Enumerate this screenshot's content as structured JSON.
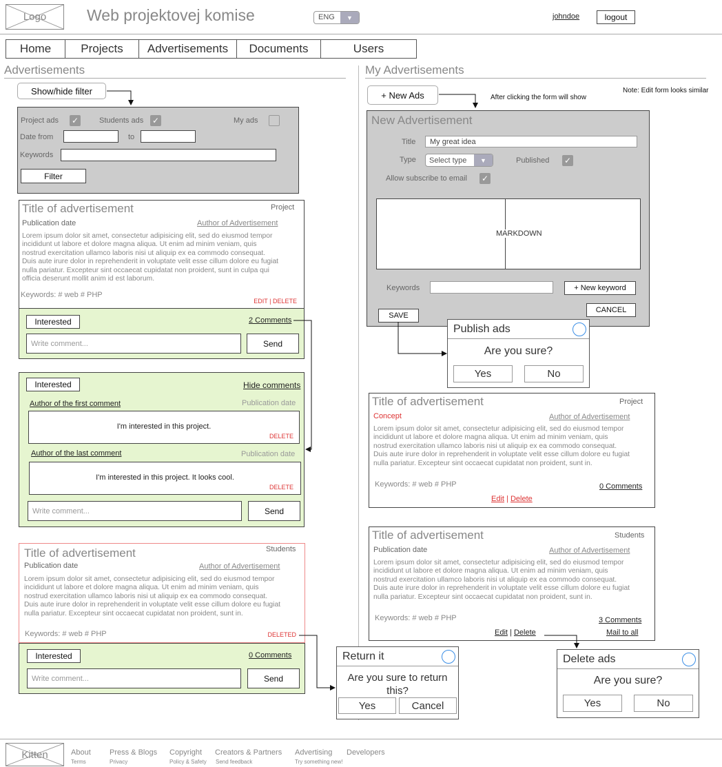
{
  "header": {
    "logo": "Logo",
    "app_title": "Web projektovej komise",
    "language": "ENG",
    "username": "johndoe",
    "logout_label": "logout"
  },
  "nav": [
    "Home",
    "Projects",
    "Advertisements",
    "Documents",
    "Users"
  ],
  "left": {
    "section_title": "Advertisements",
    "toggle_filter_label": "Show/hide filter",
    "filter": {
      "project_ads_label": "Project ads",
      "students_ads_label": "Students ads",
      "my_ads_label": "My ads",
      "date_from_label": "Date from",
      "date_to_label": "to",
      "keywords_label": "Keywords",
      "filter_button": "Filter"
    },
    "ad1": {
      "title": "Title of advertisement",
      "type": "Project",
      "date": "Publication date",
      "author": "Author of Advertisement",
      "lines": [
        "Lorem ipsum dolor sit amet, consectetur adipisicing elit, sed do eiusmod tempor",
        "incididunt ut labore et dolore magna aliqua. Ut enim ad minim veniam, quis",
        "nostrud exercitation ullamco laboris nisi ut aliquip ex ea commodo consequat.",
        "Duis aute irure dolor in reprehenderit in voluptate velit esse cillum dolore eu fugiat",
        "nulla pariatur. Excepteur sint occaecat cupidatat non proident, sunt in culpa qui",
        "officia deserunt mollit anim id est laborum."
      ],
      "keywords": "Keywords:  # web # PHP",
      "actions": "EDIT | DELETE"
    },
    "ad1_panel": {
      "interested": "Interested",
      "comments": "2 Comments",
      "comment_placeholder": "Write comment...",
      "send": "Send"
    },
    "comments_panel": {
      "interested": "Interested",
      "hide_comments": "Hide comments",
      "first_author": "Author of the first comment",
      "first_date": "Publication date",
      "first_text": "I'm interested in this project.",
      "first_delete": "DELETE",
      "last_author": "Author of the last comment",
      "last_date": "Publication date",
      "last_text": "I'm interested in this project. It looks cool.",
      "last_delete": "DELETE",
      "comment_placeholder": "Write comment...",
      "send": "Send"
    },
    "ad2": {
      "title": "Title of advertisement",
      "type": "Students",
      "date": "Publication date",
      "author": "Author of Advertisement",
      "lines": [
        "Lorem ipsum dolor sit amet, consectetur adipisicing elit, sed do eiusmod tempor",
        "incididunt ut labore et dolore magna aliqua. Ut enim ad minim veniam, quis",
        "nostrud exercitation ullamco laboris nisi ut aliquip ex ea commodo consequat.",
        "Duis aute irure dolor in reprehenderit in voluptate velit esse cillum dolore eu fugiat",
        "nulla pariatur. Excepteur sint occaecat cupidatat non proident, sunt in."
      ],
      "keywords": "Keywords:  # web # PHP",
      "status": "DELETED"
    },
    "ad2_panel": {
      "interested": "Interested",
      "comments": "0 Comments",
      "comment_placeholder": "Write comment...",
      "send": "Send"
    }
  },
  "right": {
    "section_title": "My Advertisements",
    "new_ads_label": "+ New Ads",
    "annotation_click": "After clicking the form will show",
    "annotation_edit": "Note: Edit form looks similar",
    "form": {
      "title": "New Advertisement",
      "title_label": "Title",
      "title_value": "My great idea",
      "type_label": "Type",
      "type_value": "Select type",
      "published_label": "Published",
      "subscribe_label": "Allow subscribe to email",
      "editor_label": "MARKDOWN",
      "keywords_label": "Keywords",
      "new_keyword": "+ New keyword",
      "cancel": "CANCEL",
      "save": "SAVE"
    },
    "publish_dialog": {
      "title": "Publish ads",
      "question": "Are you sure?",
      "yes": "Yes",
      "no": "No"
    },
    "ad1": {
      "title": "Title of advertisement",
      "type": "Project",
      "status": "Concept",
      "author": "Author of Advertisement",
      "lines": [
        "Lorem ipsum dolor sit amet, consectetur adipisicing elit, sed do eiusmod tempor",
        "incididunt ut labore et dolore magna aliqua. Ut enim ad minim veniam, quis",
        "nostrud exercitation ullamco laboris nisi ut aliquip ex ea commodo consequat.",
        "Duis aute irure dolor in reprehenderit in voluptate velit esse cillum dolore eu fugiat",
        "nulla pariatur. Excepteur sint occaecat cupidatat non proident, sunt in."
      ],
      "keywords": "Keywords:  # web # PHP",
      "comments": "0 Comments",
      "edit": "Edit",
      "delete": "Delete"
    },
    "ad2": {
      "title": "Title of advertisement",
      "type": "Students",
      "date": "Publication date",
      "author": "Author of Advertisement",
      "lines": [
        "Lorem ipsum dolor sit amet, consectetur adipisicing elit, sed do eiusmod tempor",
        "incididunt ut labore et dolore magna aliqua. Ut enim ad minim veniam, quis",
        "nostrud exercitation ullamco laboris nisi ut aliquip ex ea commodo consequat.",
        "Duis aute irure dolor in reprehenderit in voluptate velit esse cillum dolore eu fugiat",
        "nulla pariatur. Excepteur sint occaecat cupidatat non proident, sunt in."
      ],
      "keywords": "Keywords:  # web # PHP",
      "comments": "3 Comments",
      "edit": "Edit",
      "delete": "Delete",
      "mail_all": "Mail to all"
    },
    "delete_dialog": {
      "title": "Delete ads",
      "question": "Are you sure?",
      "yes": "Yes",
      "no": "No"
    }
  },
  "return_dialog": {
    "title": "Return it",
    "question_line1": "Are you sure to return",
    "question_line2": "this?",
    "yes": "Yes",
    "cancel": "Cancel"
  },
  "footer": {
    "logo": "Kitten",
    "links": [
      "About",
      "Press & Blogs",
      "Copyright",
      "Creators & Partners",
      "Advertising",
      "Developers"
    ],
    "sublinks": [
      "Terms",
      "Privacy",
      "Policy & Safety",
      "Send feedback",
      "Try something new!"
    ]
  }
}
